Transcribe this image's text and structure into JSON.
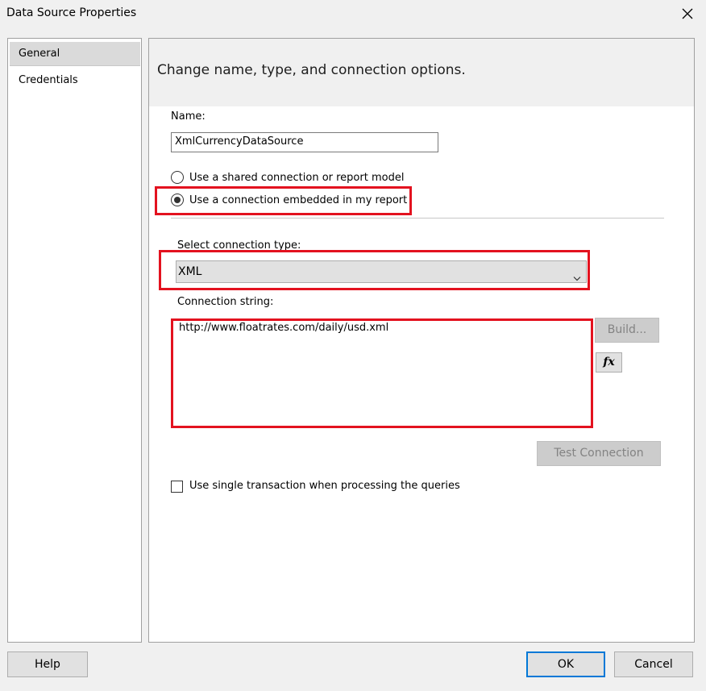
{
  "window": {
    "title": "Data Source Properties"
  },
  "sidebar": {
    "items": [
      {
        "label": "General",
        "selected": true
      },
      {
        "label": "Credentials",
        "selected": false
      }
    ]
  },
  "main": {
    "heading": "Change name, type, and connection options.",
    "name_label": "Name:",
    "name_value": "XmlCurrencyDataSource",
    "radio_shared_label": "Use a shared connection or report model",
    "radio_embedded_label": "Use a connection embedded in my report",
    "selected_radio": "embedded",
    "connection_type_label": "Select connection type:",
    "connection_type_value": "XML",
    "connection_string_label": "Connection string:",
    "connection_string_value": "http://www.floatrates.com/daily/usd.xml",
    "build_button": "Build...",
    "fx_button": "fx",
    "test_connection_button": "Test Connection",
    "single_transaction_label": "Use single transaction when processing the queries",
    "single_transaction_checked": false
  },
  "footer": {
    "help": "Help",
    "ok": "OK",
    "cancel": "Cancel"
  },
  "colors": {
    "highlight": "#e3121f",
    "accent": "#0078d7"
  },
  "icons": {
    "close": "close-icon",
    "dropdown": "chevron-down-icon",
    "expression": "fx-icon"
  }
}
